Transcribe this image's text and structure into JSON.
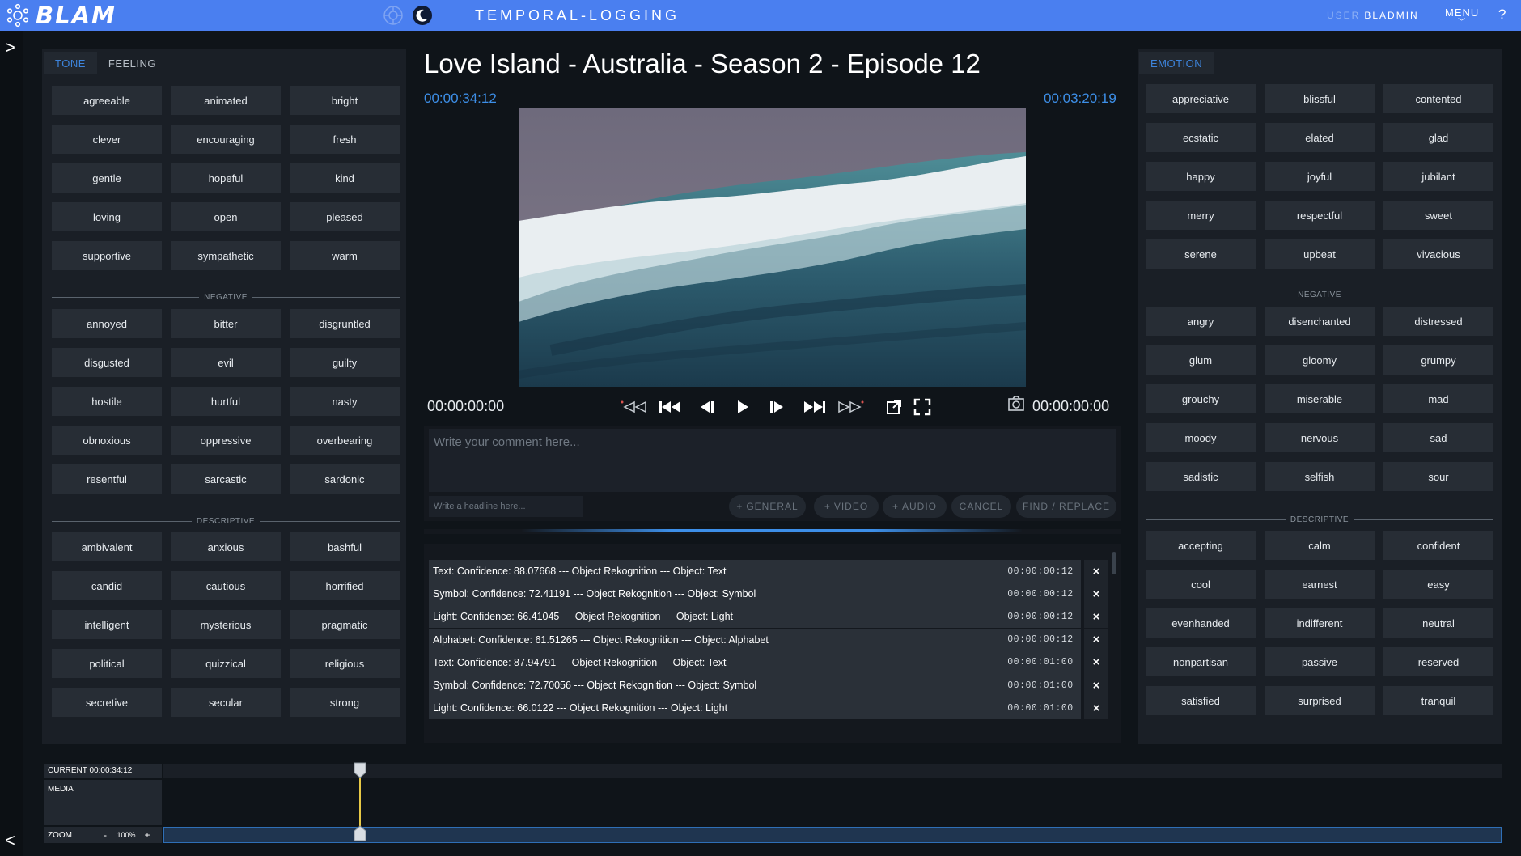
{
  "header": {
    "brand": "BLAM",
    "app_title": "TEMPORAL-LOGGING",
    "user_label": "USER",
    "user_name": "BLADMIN",
    "menu_label": "MENU",
    "help_label": "?",
    "icons": [
      "blam-logo-icon",
      "settings-wheel-icon",
      "moon-icon",
      "chevron-down-icon",
      "help-icon"
    ],
    "accent_color": "#4a7ff0"
  },
  "rail": {
    "expand_icon": "chevron-right-icon",
    "collapse_icon": "chevron-left-icon",
    "expand_glyph": ">",
    "collapse_glyph": "<"
  },
  "left_panel": {
    "tabs": [
      {
        "label": "TONE",
        "active": true
      },
      {
        "label": "FEELING",
        "active": false
      }
    ],
    "positive": [
      "agreeable",
      "animated",
      "bright",
      "clever",
      "encouraging",
      "fresh",
      "gentle",
      "hopeful",
      "kind",
      "loving",
      "open",
      "pleased",
      "supportive",
      "sympathetic",
      "warm"
    ],
    "negative_label": "NEGATIVE",
    "negative": [
      "annoyed",
      "bitter",
      "disgruntled",
      "disgusted",
      "evil",
      "guilty",
      "hostile",
      "hurtful",
      "nasty",
      "obnoxious",
      "oppressive",
      "overbearing",
      "resentful",
      "sarcastic",
      "sardonic"
    ],
    "descriptive_label": "DESCRIPTIVE",
    "descriptive": [
      "ambivalent",
      "anxious",
      "bashful",
      "candid",
      "cautious",
      "horrified",
      "intelligent",
      "mysterious",
      "pragmatic",
      "political",
      "quizzical",
      "religious",
      "secretive",
      "secular",
      "strong"
    ]
  },
  "right_panel": {
    "tabs": [
      {
        "label": "EMOTION",
        "active": true
      }
    ],
    "positive": [
      "appreciative",
      "blissful",
      "contented",
      "ecstatic",
      "elated",
      "glad",
      "happy",
      "joyful",
      "jubilant",
      "merry",
      "respectful",
      "sweet",
      "serene",
      "upbeat",
      "vivacious"
    ],
    "negative_label": "NEGATIVE",
    "negative": [
      "angry",
      "disenchanted",
      "distressed",
      "glum",
      "gloomy",
      "grumpy",
      "grouchy",
      "miserable",
      "mad",
      "moody",
      "nervous",
      "sad",
      "sadistic",
      "selfish",
      "sour"
    ],
    "descriptive_label": "DESCRIPTIVE",
    "descriptive": [
      "accepting",
      "calm",
      "confident",
      "cool",
      "earnest",
      "easy",
      "evenhanded",
      "indifferent",
      "neutral",
      "nonpartisan",
      "passive",
      "reserved",
      "satisfied",
      "surprised",
      "tranquil"
    ]
  },
  "player": {
    "title": "Love Island - Australia - Season 2 - Episode 12",
    "current_timecode": "00:00:34:12",
    "duration": "00:03:20:19",
    "in_point": "00:00:00:00",
    "out_point": "00:00:00:00",
    "timecode_color": "#3d8fe8",
    "controls": [
      "rewind-fast-icon",
      "skip-back-icon",
      "step-back-icon",
      "play-icon",
      "step-forward-icon",
      "skip-forward-icon",
      "forward-fast-icon",
      "popout-icon",
      "fullscreen-icon",
      "snapshot-icon"
    ]
  },
  "comment": {
    "placeholder": "Write your comment here...",
    "headline_placeholder": "Write a headline here...",
    "buttons": {
      "general": "GENERAL",
      "video": "VIDEO",
      "audio": "AUDIO",
      "cancel": "CANCEL",
      "find_replace": "FIND / REPLACE"
    },
    "plus": "+"
  },
  "log": {
    "rows": [
      {
        "text": "Text: Confidence: 88.07668 --- Object Rekognition --- Object: Text",
        "time": "00:00:00:12"
      },
      {
        "text": "Symbol: Confidence: 72.41191 --- Object Rekognition --- Object: Symbol",
        "time": "00:00:00:12"
      },
      {
        "text": "Light: Confidence: 66.41045 --- Object Rekognition --- Object: Light",
        "time": "00:00:00:12"
      },
      {
        "text": "Alphabet: Confidence: 61.51265 --- Object Rekognition --- Object: Alphabet",
        "time": "00:00:00:12"
      },
      {
        "text": "Text: Confidence: 87.94791 --- Object Rekognition --- Object: Text",
        "time": "00:00:01:00"
      },
      {
        "text": "Symbol: Confidence: 72.70056 --- Object Rekognition --- Object: Symbol",
        "time": "00:00:01:00"
      },
      {
        "text": "Light: Confidence: 66.0122 --- Object Rekognition --- Object: Light",
        "time": "00:00:01:00"
      }
    ],
    "delete_glyph": "×"
  },
  "timeline": {
    "current_label": "CURRENT 00:00:34:12",
    "media_label": "MEDIA",
    "zoom_label": "ZOOM",
    "zoom_minus": "-",
    "zoom_value": "100%",
    "zoom_plus": "+",
    "playhead_color": "#e7c946"
  }
}
